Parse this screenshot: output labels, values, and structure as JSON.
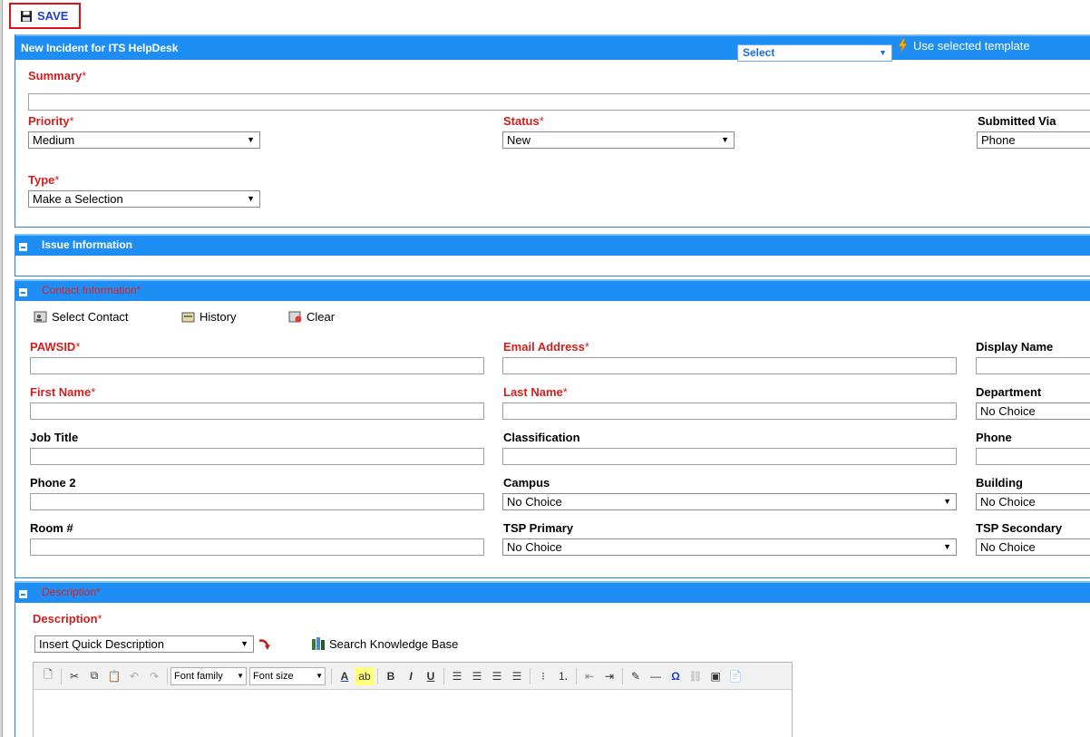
{
  "toolbar": {
    "save_label": "SAVE"
  },
  "incident": {
    "title": "New Incident for ITS HelpDesk",
    "template_select": "Select",
    "use_template_label": "Use selected template",
    "summary_label": "Summary",
    "priority_label": "Priority",
    "priority_value": "Medium",
    "status_label": "Status",
    "status_value": "New",
    "submitted_via_label": "Submitted Via",
    "submitted_via_value": "Phone",
    "type_label": "Type",
    "type_value": "Make a Selection"
  },
  "issue": {
    "title": "Issue Information"
  },
  "contact": {
    "title": "Contact Information*",
    "select_contact": "Select Contact",
    "history": "History",
    "clear": "Clear",
    "pawsid_label": "PAWSID",
    "email_label": "Email Address",
    "display_name_label": "Display Name",
    "first_name_label": "First Name",
    "last_name_label": "Last Name",
    "department_label": "Department",
    "department_value": "No Choice",
    "job_title_label": "Job Title",
    "classification_label": "Classification",
    "phone_label": "Phone",
    "phone2_label": "Phone 2",
    "campus_label": "Campus",
    "campus_value": "No Choice",
    "building_label": "Building",
    "building_value": "No Choice",
    "room_label": "Room #",
    "tsp_primary_label": "TSP Primary",
    "tsp_primary_value": "No Choice",
    "tsp_secondary_label": "TSP Secondary",
    "tsp_secondary_value": "No Choice"
  },
  "description": {
    "title": "Description*",
    "label": "Description",
    "quick_desc": "Insert Quick Description",
    "search_kb": "Search Knowledge Base",
    "font_family": "Font family",
    "font_size": "Font size"
  }
}
